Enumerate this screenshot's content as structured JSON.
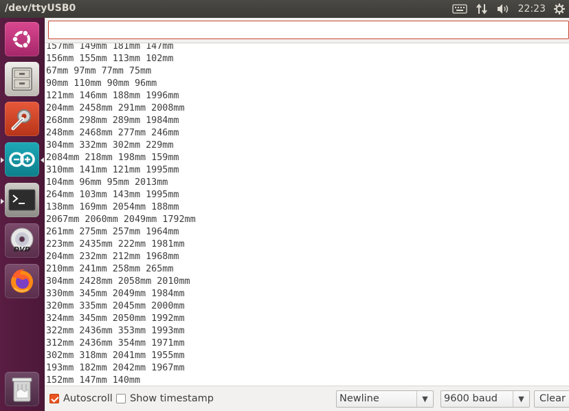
{
  "window": {
    "title": "/dev/ttyUSB0"
  },
  "tray": {
    "clock": "22:23"
  },
  "launcher": {
    "items": [
      {
        "name": "ubuntu-dash-icon"
      },
      {
        "name": "files-icon"
      },
      {
        "name": "system-settings-icon"
      },
      {
        "name": "arduino-icon"
      },
      {
        "name": "terminal-icon"
      },
      {
        "name": "dvd-icon"
      },
      {
        "name": "firefox-icon"
      },
      {
        "name": "trash-icon"
      }
    ]
  },
  "send": {
    "value": ""
  },
  "serial_output": [
    "157mm 149mm 181mm 147mm",
    "156mm 155mm 113mm 102mm",
    "67mm 97mm 77mm 75mm",
    "90mm 110mm 90mm 96mm",
    "121mm 146mm 188mm 1996mm",
    "204mm 2458mm 291mm 2008mm",
    "268mm 298mm 289mm 1984mm",
    "248mm 2468mm 277mm 246mm",
    "304mm 332mm 302mm 229mm",
    "2084mm 218mm 198mm 159mm",
    "310mm 141mm 121mm 1995mm",
    "104mm 96mm 95mm 2013mm",
    "264mm 103mm 143mm 1995mm",
    "138mm 169mm 2054mm 188mm",
    "2067mm 2060mm 2049mm 1792mm",
    "261mm 275mm 257mm 1964mm",
    "223mm 2435mm 222mm 1981mm",
    "204mm 232mm 212mm 1968mm",
    "210mm 241mm 258mm 265mm",
    "304mm 2428mm 2058mm 2010mm",
    "330mm 345mm 2049mm 1984mm",
    "320mm 335mm 2045mm 2000mm",
    "324mm 345mm 2050mm 1992mm",
    "322mm 2436mm 353mm 1993mm",
    "312mm 2436mm 354mm 1971mm",
    "302mm 318mm 2041mm 1955mm",
    "193mm 182mm 2042mm 1967mm",
    "152mm 147mm 140mm"
  ],
  "footer": {
    "autoscroll_label": "Autoscroll",
    "autoscroll_checked": true,
    "timestamp_label": "Show timestamp",
    "timestamp_checked": false,
    "line_ending": "Newline",
    "baud": "9600 baud",
    "clear_label": "Clear"
  },
  "colors": {
    "accent": "#e95420",
    "launcher_bg": "#5a1d43",
    "input_border": "#c8452f"
  }
}
